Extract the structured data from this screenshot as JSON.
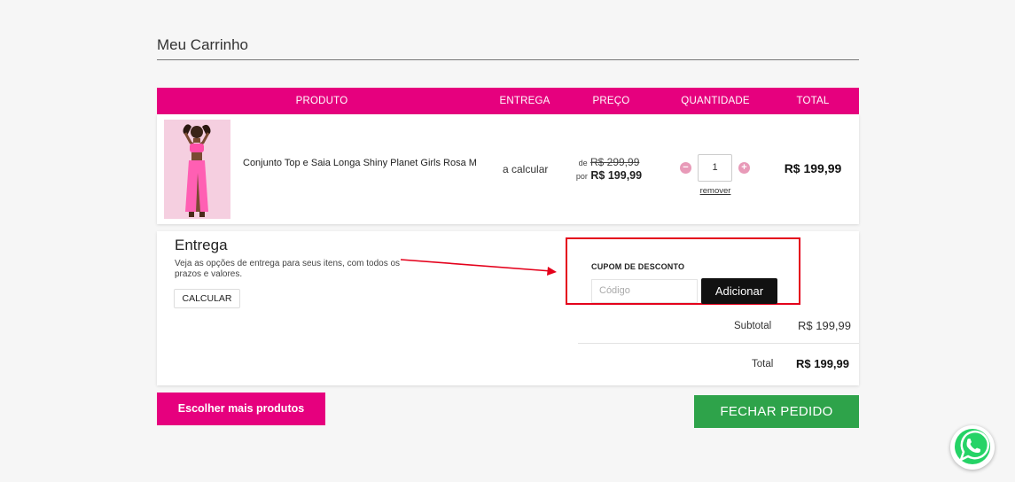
{
  "page": {
    "title": "Meu Carrinho"
  },
  "cart_header": {
    "produto": "PRODUTO",
    "entrega": "ENTREGA",
    "preco": "PREÇO",
    "quantidade": "QUANTIDADE",
    "total": "TOTAL"
  },
  "items": [
    {
      "name": "Conjunto Top e Saia Longa Shiny Planet Girls Rosa M",
      "delivery": "a calcular",
      "price_old_prefix": "de",
      "price_old": "R$ 299,99",
      "price_new_prefix": "por",
      "price_new": "R$ 199,99",
      "quantity": "1",
      "remove_label": "remover",
      "total": "R$ 199,99",
      "image_icon": "product-photo"
    }
  ],
  "delivery": {
    "title": "Entrega",
    "description": "Veja as opções de entrega para seus itens, com todos os prazos e valores.",
    "calc_button": "CALCULAR"
  },
  "coupon": {
    "label": "CUPOM DE DESCONTO",
    "placeholder": "Código",
    "button": "Adicionar"
  },
  "summary": {
    "subtotal_label": "Subtotal",
    "subtotal_value": "R$ 199,99",
    "total_label": "Total",
    "total_value": "R$ 199,99"
  },
  "actions": {
    "more_products": "Escolher mais produtos",
    "checkout": "FECHAR PEDIDO"
  },
  "colors": {
    "brand_pink": "#e6007e",
    "checkout_green": "#2ea34a",
    "annotation_red": "#e4001b",
    "whatsapp_green": "#25d366"
  },
  "icons": {
    "qty_minus": "minus-circle-icon",
    "qty_plus": "plus-circle-icon",
    "whatsapp": "whatsapp-icon"
  }
}
